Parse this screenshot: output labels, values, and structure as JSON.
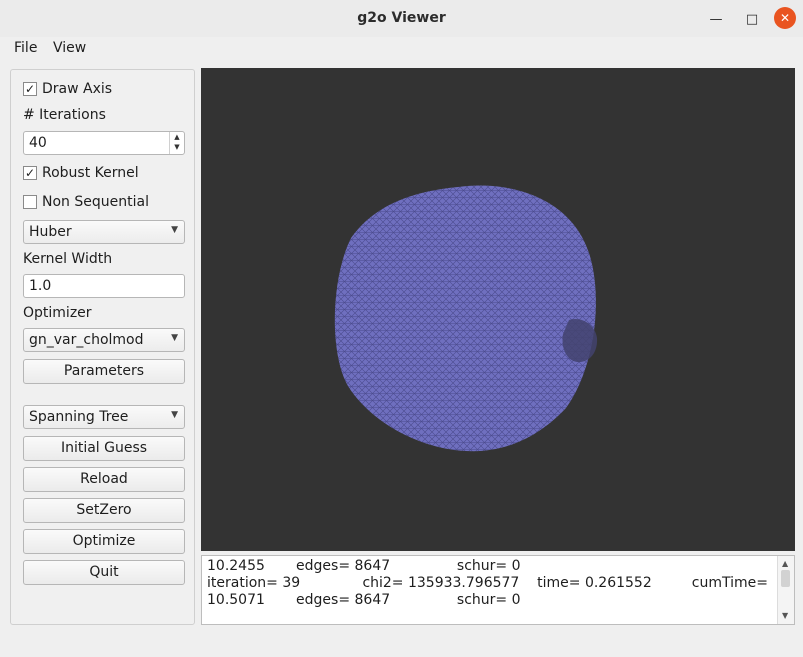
{
  "window": {
    "title": "g2o Viewer",
    "minimize_icon": "—",
    "maximize_icon": "□",
    "close_icon": "✕"
  },
  "menu": {
    "file": "File",
    "view": "View"
  },
  "panel": {
    "draw_axis": {
      "label": "Draw Axis",
      "mark": "✓"
    },
    "iterations_label": "# Iterations",
    "iterations_value": "40",
    "robust_kernel": {
      "label": "Robust Kernel",
      "mark": "✓"
    },
    "non_sequential": {
      "label": "Non Sequential",
      "mark": ""
    },
    "kernel_type": "Huber",
    "kernel_width_label": "Kernel Width",
    "kernel_width_value": "1.0",
    "optimizer_label": "Optimizer",
    "optimizer_value": "gn_var_cholmod",
    "parameters_button": "Parameters",
    "initial_guess_type": "Spanning Tree",
    "initial_guess_button": "Initial Guess",
    "reload_button": "Reload",
    "setzero_button": "SetZero",
    "optimize_button": "Optimize",
    "quit_button": "Quit"
  },
  "console": {
    "line1": "10.2455       edges= 8647               schur= 0",
    "line2": "iteration= 39              chi2= 135933.796577    time= 0.261552         cumTime=",
    "line3": "10.5071       edges= 8647               schur= 0"
  },
  "colors": {
    "viewer_bg": "#333333",
    "sphere": "#6f6fbf",
    "close_button": "#e95420"
  }
}
